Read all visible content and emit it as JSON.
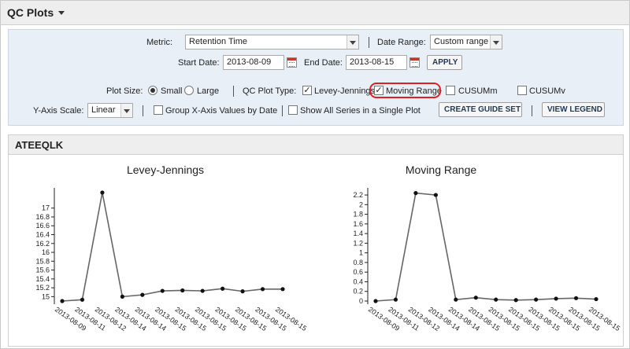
{
  "header": {
    "title": "QC Plots"
  },
  "form": {
    "metric_label": "Metric:",
    "metric_value": "Retention Time",
    "date_range_label": "Date Range:",
    "date_range_value": "Custom range",
    "start_date_label": "Start Date:",
    "start_date_value": "2013-08-09",
    "end_date_label": "End Date:",
    "end_date_value": "2013-08-15",
    "apply_label": "APPLY",
    "plot_size_label": "Plot Size:",
    "plot_size_small": "Small",
    "plot_size_large": "Large",
    "plot_size_selected": "Small",
    "qc_plot_type_label": "QC Plot Type:",
    "plot_types": [
      {
        "label": "Levey-Jennings",
        "checked": true
      },
      {
        "label": "Moving Range",
        "checked": true
      },
      {
        "label": "CUSUMm",
        "checked": false
      },
      {
        "label": "CUSUMv",
        "checked": false
      }
    ],
    "yaxis_label": "Y-Axis Scale:",
    "yaxis_value": "Linear",
    "group_x_label": "Group X-Axis Values by Date",
    "group_x_checked": false,
    "show_all_label": "Show All Series in a Single Plot",
    "show_all_checked": false,
    "create_guide_label": "CREATE GUIDE SET",
    "view_legend_label": "VIEW LEGEND"
  },
  "section": {
    "title": "ATEEQLK"
  },
  "chart_data": [
    {
      "type": "line",
      "title": "Levey-Jennings",
      "x": [
        "2013-08-09",
        "2013-08-11",
        "2013-08-12",
        "2013-08-14",
        "2013-08-14",
        "2013-08-15",
        "2013-08-15",
        "2013-08-15",
        "2013-08-15",
        "2013-08-15",
        "2013-08-15",
        "2013-08-15"
      ],
      "values": [
        14.9,
        14.93,
        17.35,
        15.0,
        15.04,
        15.13,
        15.14,
        15.13,
        15.18,
        15.12,
        15.17,
        15.17
      ],
      "ylim": [
        14.9,
        17.35
      ],
      "yticks": [
        "15",
        "15.2",
        "15.4",
        "15.6",
        "15.8",
        "16",
        "16.2",
        "16.4",
        "16.6",
        "16.8",
        "17"
      ],
      "color": "#666666"
    },
    {
      "type": "line",
      "title": "Moving Range",
      "x": [
        "2013-08-09",
        "2013-08-11",
        "2013-08-12",
        "2013-08-14",
        "2013-08-14",
        "2013-08-15",
        "2013-08-15",
        "2013-08-15",
        "2013-08-15",
        "2013-08-15",
        "2013-08-15",
        "2013-08-15"
      ],
      "values": [
        0.0,
        0.03,
        2.24,
        2.2,
        0.03,
        0.07,
        0.03,
        0.02,
        0.03,
        0.05,
        0.06,
        0.04
      ],
      "ylim": [
        0,
        2.25
      ],
      "yticks": [
        "0",
        "0.2",
        "0.4",
        "0.6",
        "0.8",
        "1",
        "1.2",
        "1.4",
        "1.6",
        "1.8",
        "2",
        "2.2"
      ],
      "color": "#666666"
    }
  ]
}
